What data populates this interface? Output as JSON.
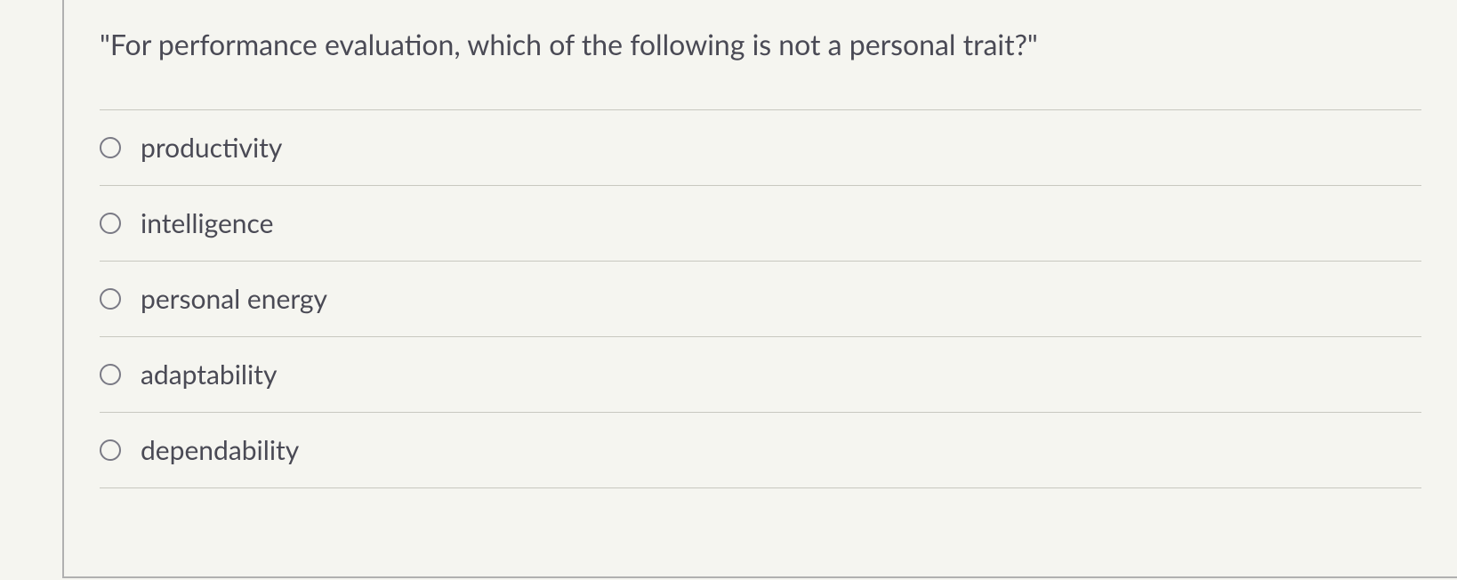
{
  "question": {
    "text": "\"For performance evaluation, which of the following is not a personal trait?\"",
    "options": [
      {
        "label": "productivity"
      },
      {
        "label": "intelligence"
      },
      {
        "label": "personal energy"
      },
      {
        "label": "adaptability"
      },
      {
        "label": "dependability"
      }
    ]
  }
}
